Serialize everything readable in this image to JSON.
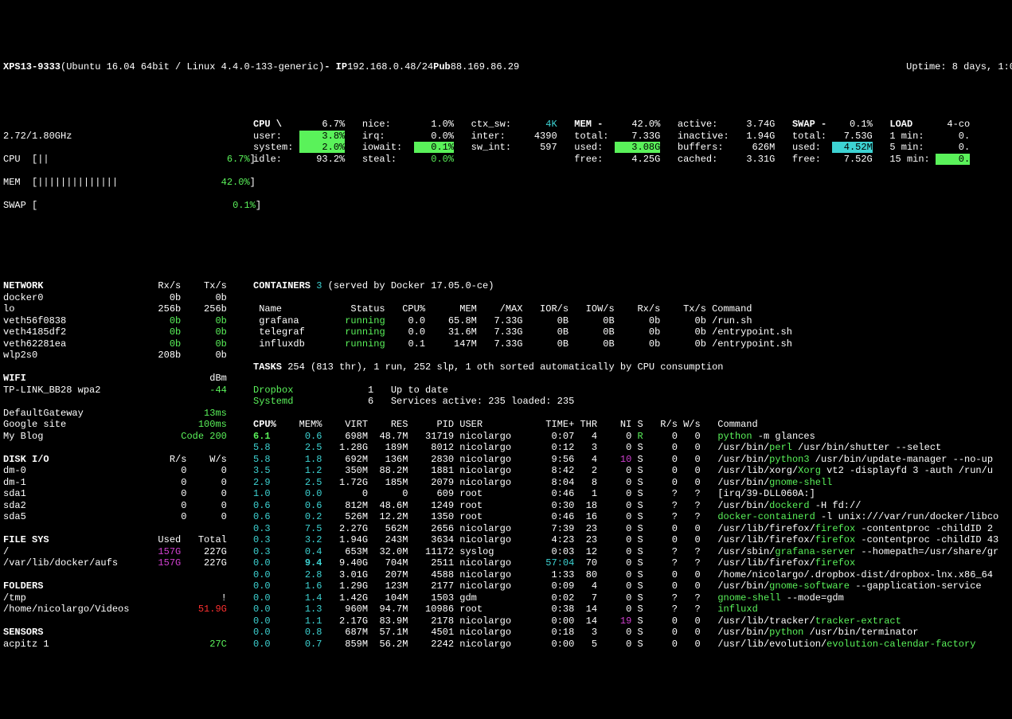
{
  "header": {
    "hostname": "XPS13-9333",
    "os": "(Ubuntu 16.04 64bit / Linux 4.4.0-133-generic)",
    "ip_label": "- IP",
    "ip": "192.168.0.48/24",
    "pub_label": "Pub",
    "pub_ip": "88.169.86.29",
    "uptime": "Uptime: 8 days, 1:0"
  },
  "quick": {
    "cpu_ghz": "2.72/1.80GHz",
    "cpu_bar": "CPU  [||",
    "cpu_pct": "6.7%",
    "mem_bar": "MEM  [||||||||||||||",
    "mem_pct": "42.0%",
    "swap_bar": "SWAP [",
    "swap_pct": "0.1%"
  },
  "cpu": {
    "title": "CPU \\",
    "total": "6.7%",
    "user_l": "user:",
    "user_v": "3.8%",
    "system_l": "system:",
    "system_v": "2.0%",
    "idle_l": "idle:",
    "idle_v": "93.2%",
    "nice_l": "nice:",
    "nice_v": "1.0%",
    "irq_l": "irq:",
    "irq_v": "0.0%",
    "iowait_l": "iowait:",
    "iowait_v": "0.1%",
    "steal_l": "steal:",
    "steal_v": "0.0%",
    "ctx_l": "ctx_sw:",
    "ctx_v": "4K",
    "inter_l": "inter:",
    "inter_v": "4390",
    "swint_l": "sw_int:",
    "swint_v": "597"
  },
  "mem": {
    "title": "MEM -",
    "total_pct": "42.0%",
    "total_l": "total:",
    "total_v": "7.33G",
    "used_l": "used:",
    "used_v": "3.08G",
    "free_l": "free:",
    "free_v": "4.25G",
    "active_l": "active:",
    "active_v": "3.74G",
    "inactive_l": "inactive:",
    "inactive_v": "1.94G",
    "buffers_l": "buffers:",
    "buffers_v": "626M",
    "cached_l": "cached:",
    "cached_v": "3.31G"
  },
  "swap": {
    "title": "SWAP -",
    "pct": "0.1%",
    "total_l": "total:",
    "total_v": "7.53G",
    "used_l": "used:",
    "used_v": "4.52M",
    "free_l": "free:",
    "free_v": "7.52G"
  },
  "load": {
    "title": "LOAD",
    "cores": "4-co",
    "l1_l": "1 min:",
    "l1_v": "0.",
    "l5_l": "5 min:",
    "l5_v": "0.",
    "l15_l": "15 min:",
    "l15_v": "0."
  },
  "network": {
    "title": "NETWORK",
    "rx": "Rx/s",
    "tx": "Tx/s",
    "rows": [
      {
        "if": "docker0",
        "rx": "0b",
        "tx": "0b"
      },
      {
        "if": "lo",
        "rx": "256b",
        "tx": "256b"
      },
      {
        "if": "veth56f0838",
        "rx": "0b",
        "tx": "0b",
        "green": true
      },
      {
        "if": "veth4185df2",
        "rx": "0b",
        "tx": "0b",
        "green": true
      },
      {
        "if": "veth62281ea",
        "rx": "0b",
        "tx": "0b",
        "green": true
      },
      {
        "if": "wlp2s0",
        "rx": "208b",
        "tx": "0b"
      }
    ]
  },
  "containers": {
    "title": "CONTAINERS",
    "count": "3",
    "info": "(served by Docker 17.05.0-ce)",
    "hdr": {
      "name": "Name",
      "status": "Status",
      "cpu": "CPU%",
      "mem": "MEM",
      "max": "/MAX",
      "ior": "IOR/s",
      "iow": "IOW/s",
      "rx": "Rx/s",
      "tx": "Tx/s",
      "cmd": "Command"
    },
    "rows": [
      {
        "name": "grafana",
        "status": "running",
        "cpu": "0.0",
        "mem": "65.8M",
        "max": "7.33G",
        "ior": "0B",
        "iow": "0B",
        "rx": "0b",
        "tx": "0b",
        "cmd": "/run.sh"
      },
      {
        "name": "telegraf",
        "status": "running",
        "cpu": "0.0",
        "mem": "31.6M",
        "max": "7.33G",
        "ior": "0B",
        "iow": "0B",
        "rx": "0b",
        "tx": "0b",
        "cmd": "/entrypoint.sh"
      },
      {
        "name": "influxdb",
        "status": "running",
        "cpu": "0.1",
        "mem": "147M",
        "max": "7.33G",
        "ior": "0B",
        "iow": "0B",
        "rx": "0b",
        "tx": "0b",
        "cmd": "/entrypoint.sh"
      }
    ]
  },
  "wifi": {
    "title": "WIFI",
    "unit": "dBm",
    "rows": [
      {
        "ssid": "TP-LINK_BB28 wpa2",
        "val": "-44"
      }
    ]
  },
  "ports": {
    "rows": [
      {
        "name": "DefaultGateway",
        "val": "13ms",
        "cls": "green"
      },
      {
        "name": "Google site",
        "val": "100ms",
        "cls": "green"
      },
      {
        "name": "My Blog",
        "val": "Code 200",
        "cls": "green"
      }
    ]
  },
  "tasks": {
    "line": "TASKS 254 (813 thr), 1 run, 252 slp, 1 oth sorted automatically by CPU consumption"
  },
  "amps": [
    {
      "name": "Dropbox",
      "n": "1",
      "msg": "Up to date"
    },
    {
      "name": "Systemd",
      "n": "6",
      "msg": "Services active: 235 loaded: 235"
    }
  ],
  "diskio": {
    "title": "DISK I/O",
    "r": "R/s",
    "w": "W/s",
    "rows": [
      {
        "d": "dm-0",
        "r": "0",
        "w": "0"
      },
      {
        "d": "dm-1",
        "r": "0",
        "w": "0"
      },
      {
        "d": "sda1",
        "r": "0",
        "w": "0"
      },
      {
        "d": "sda2",
        "r": "0",
        "w": "0"
      },
      {
        "d": "sda5",
        "r": "0",
        "w": "0"
      }
    ]
  },
  "fs": {
    "title": "FILE SYS",
    "u": "Used",
    "t": "Total",
    "rows": [
      {
        "m": "/",
        "u": "157G",
        "t": "227G",
        "cls": "magenta"
      },
      {
        "m": "/var/lib/docker/aufs",
        "u": "157G",
        "t": "227G",
        "cls": "magenta"
      }
    ]
  },
  "folders": {
    "title": "FOLDERS",
    "rows": [
      {
        "p": "/tmp",
        "v": "!",
        "cls": ""
      },
      {
        "p": "/home/nicolargo/Videos",
        "v": "51.9G",
        "cls": "red"
      }
    ]
  },
  "sensors": {
    "title": "SENSORS",
    "rows": [
      {
        "n": "acpitz 1",
        "v": "27C",
        "cls": "green"
      }
    ]
  },
  "proc_hdr": {
    "cpu": "CPU%",
    "mem": "MEM%",
    "virt": "VIRT",
    "res": "RES",
    "pid": "PID",
    "user": "USER",
    "time": "TIME+",
    "thr": "THR",
    "ni": "NI",
    "s": "S",
    "rs": "R/s",
    "ws": "W/s",
    "cmd": "Command"
  },
  "procs": [
    {
      "cpu": "6.1",
      "cc": "green bold",
      "mem": "0.6",
      "virt": "698M",
      "res": "48.7M",
      "pid": "31719",
      "user": "nicolargo",
      "time": "0:07",
      "thr": "4",
      "ni": "0",
      "s": "R",
      "sc": "green",
      "rs": "0",
      "ws": "0",
      "cmd": [
        {
          "t": "python",
          "c": "green"
        },
        {
          "t": " -m glances"
        }
      ]
    },
    {
      "cpu": "5.8",
      "cc": "cyan",
      "mem": "2.5",
      "virt": "1.28G",
      "res": "189M",
      "pid": "8012",
      "user": "nicolargo",
      "time": "0:12",
      "thr": "3",
      "ni": "0",
      "s": "S",
      "rs": "0",
      "ws": "0",
      "cmd": [
        {
          "t": "/usr/bin/"
        },
        {
          "t": "perl",
          "c": "green"
        },
        {
          "t": " /usr/bin/shutter --select"
        }
      ]
    },
    {
      "cpu": "5.8",
      "cc": "cyan",
      "mem": "1.8",
      "virt": "692M",
      "res": "136M",
      "pid": "2830",
      "user": "nicolargo",
      "time": "9:56",
      "thr": "4",
      "ni": "10",
      "nic": "magenta",
      "s": "S",
      "rs": "0",
      "ws": "0",
      "cmd": [
        {
          "t": "/usr/bin/"
        },
        {
          "t": "python3",
          "c": "green"
        },
        {
          "t": " /usr/bin/update-manager --no-up"
        }
      ]
    },
    {
      "cpu": "3.5",
      "cc": "cyan",
      "mem": "1.2",
      "virt": "350M",
      "res": "88.2M",
      "pid": "1881",
      "user": "nicolargo",
      "time": "8:42",
      "thr": "2",
      "ni": "0",
      "s": "S",
      "rs": "0",
      "ws": "0",
      "cmd": [
        {
          "t": "/usr/lib/xorg/"
        },
        {
          "t": "Xorg",
          "c": "green"
        },
        {
          "t": " vt2 -displayfd 3 -auth /run/u"
        }
      ]
    },
    {
      "cpu": "2.9",
      "cc": "cyan",
      "mem": "2.5",
      "virt": "1.72G",
      "res": "185M",
      "pid": "2079",
      "user": "nicolargo",
      "time": "8:04",
      "thr": "8",
      "ni": "0",
      "s": "S",
      "rs": "0",
      "ws": "0",
      "cmd": [
        {
          "t": "/usr/bin/"
        },
        {
          "t": "gnome-shell",
          "c": "green"
        }
      ]
    },
    {
      "cpu": "1.0",
      "cc": "cyan",
      "mem": "0.0",
      "virt": "0",
      "res": "0",
      "pid": "609",
      "user": "root",
      "time": "0:46",
      "thr": "1",
      "ni": "0",
      "s": "S",
      "rs": "?",
      "ws": "?",
      "cmd": [
        {
          "t": "[irq/39-DLL060A:]"
        }
      ]
    },
    {
      "cpu": "0.6",
      "cc": "cyan",
      "mem": "0.6",
      "virt": "812M",
      "res": "48.6M",
      "pid": "1249",
      "user": "root",
      "time": "0:30",
      "thr": "18",
      "ni": "0",
      "s": "S",
      "rs": "?",
      "ws": "?",
      "cmd": [
        {
          "t": "/usr/bin/"
        },
        {
          "t": "dockerd",
          "c": "green"
        },
        {
          "t": " -H fd://"
        }
      ]
    },
    {
      "cpu": "0.6",
      "cc": "cyan",
      "mem": "0.2",
      "virt": "526M",
      "res": "12.2M",
      "pid": "1350",
      "user": "root",
      "time": "0:46",
      "thr": "16",
      "ni": "0",
      "s": "S",
      "rs": "?",
      "ws": "?",
      "cmd": [
        {
          "t": "docker-containerd",
          "c": "green"
        },
        {
          "t": " -l unix:///var/run/docker/libco"
        }
      ]
    },
    {
      "cpu": "0.3",
      "cc": "cyan",
      "mem": "7.5",
      "virt": "2.27G",
      "res": "562M",
      "pid": "2656",
      "user": "nicolargo",
      "time": "7:39",
      "thr": "23",
      "ni": "0",
      "s": "S",
      "rs": "0",
      "ws": "0",
      "cmd": [
        {
          "t": "/usr/lib/firefox/"
        },
        {
          "t": "firefox",
          "c": "green"
        },
        {
          "t": " -contentproc -childID 2"
        }
      ]
    },
    {
      "cpu": "0.3",
      "cc": "cyan",
      "mem": "3.2",
      "virt": "1.94G",
      "res": "243M",
      "pid": "3634",
      "user": "nicolargo",
      "time": "4:23",
      "thr": "23",
      "ni": "0",
      "s": "S",
      "rs": "0",
      "ws": "0",
      "cmd": [
        {
          "t": "/usr/lib/firefox/"
        },
        {
          "t": "firefox",
          "c": "green"
        },
        {
          "t": " -contentproc -childID 43"
        }
      ]
    },
    {
      "cpu": "0.3",
      "cc": "cyan",
      "mem": "0.4",
      "virt": "653M",
      "res": "32.0M",
      "pid": "11172",
      "user": "syslog",
      "time": "0:03",
      "thr": "12",
      "ni": "0",
      "s": "S",
      "rs": "?",
      "ws": "?",
      "cmd": [
        {
          "t": "/usr/sbin/"
        },
        {
          "t": "grafana-server",
          "c": "green"
        },
        {
          "t": " --homepath=/usr/share/gr"
        }
      ]
    },
    {
      "cpu": "0.0",
      "cc": "cyan",
      "mem": "9.4",
      "mc": "bold",
      "virt": "9.40G",
      "res": "704M",
      "pid": "2511",
      "user": "nicolargo",
      "time": "57:04",
      "tc": "cyan",
      "thr": "70",
      "ni": "0",
      "s": "S",
      "rs": "?",
      "ws": "?",
      "cmd": [
        {
          "t": "/usr/lib/firefox/"
        },
        {
          "t": "firefox",
          "c": "green"
        }
      ]
    },
    {
      "cpu": "0.0",
      "cc": "cyan",
      "mem": "2.8",
      "virt": "3.01G",
      "res": "207M",
      "pid": "4588",
      "user": "nicolargo",
      "time": "1:33",
      "thr": "80",
      "ni": "0",
      "s": "S",
      "rs": "0",
      "ws": "0",
      "cmd": [
        {
          "t": "/home/nicolargo/.dropbox-dist/dropbox-lnx.x86_64"
        }
      ]
    },
    {
      "cpu": "0.0",
      "cc": "cyan",
      "mem": "1.6",
      "virt": "1.29G",
      "res": "123M",
      "pid": "2177",
      "user": "nicolargo",
      "time": "0:09",
      "thr": "4",
      "ni": "0",
      "s": "S",
      "rs": "0",
      "ws": "0",
      "cmd": [
        {
          "t": "/usr/bin/"
        },
        {
          "t": "gnome-software",
          "c": "green"
        },
        {
          "t": " --gapplication-service"
        }
      ]
    },
    {
      "cpu": "0.0",
      "cc": "cyan",
      "mem": "1.4",
      "virt": "1.42G",
      "res": "104M",
      "pid": "1503",
      "user": "gdm",
      "time": "0:02",
      "thr": "7",
      "ni": "0",
      "s": "S",
      "rs": "?",
      "ws": "?",
      "cmd": [
        {
          "t": "gnome-shell",
          "c": "green"
        },
        {
          "t": " --mode=gdm"
        }
      ]
    },
    {
      "cpu": "0.0",
      "cc": "cyan",
      "mem": "1.3",
      "virt": "960M",
      "res": "94.7M",
      "pid": "10986",
      "user": "root",
      "time": "0:38",
      "thr": "14",
      "ni": "0",
      "s": "S",
      "rs": "?",
      "ws": "?",
      "cmd": [
        {
          "t": "influxd",
          "c": "green"
        }
      ]
    },
    {
      "cpu": "0.0",
      "cc": "cyan",
      "mem": "1.1",
      "virt": "2.17G",
      "res": "83.9M",
      "pid": "2178",
      "user": "nicolargo",
      "time": "0:00",
      "thr": "14",
      "ni": "19",
      "nic": "magenta",
      "s": "S",
      "rs": "0",
      "ws": "0",
      "cmd": [
        {
          "t": "/usr/lib/tracker/"
        },
        {
          "t": "tracker-extract",
          "c": "green"
        }
      ]
    },
    {
      "cpu": "0.0",
      "cc": "cyan",
      "mem": "0.8",
      "virt": "687M",
      "res": "57.1M",
      "pid": "4501",
      "user": "nicolargo",
      "time": "0:18",
      "thr": "3",
      "ni": "0",
      "s": "S",
      "rs": "0",
      "ws": "0",
      "cmd": [
        {
          "t": "/usr/bin/"
        },
        {
          "t": "python",
          "c": "green"
        },
        {
          "t": " /usr/bin/terminator"
        }
      ]
    },
    {
      "cpu": "0.0",
      "cc": "cyan",
      "mem": "0.7",
      "virt": "859M",
      "res": "56.2M",
      "pid": "2242",
      "user": "nicolargo",
      "time": "0:00",
      "thr": "5",
      "ni": "0",
      "s": "S",
      "rs": "0",
      "ws": "0",
      "cmd": [
        {
          "t": "/usr/lib/evolution/"
        },
        {
          "t": "evolution-calendar-factory",
          "c": "green"
        }
      ]
    }
  ]
}
